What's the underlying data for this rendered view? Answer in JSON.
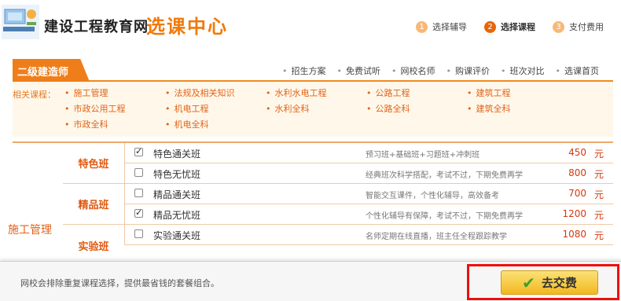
{
  "header": {
    "site_name": "建设工程教育网",
    "center_name": "选课中心",
    "steps": [
      {
        "num": "1",
        "label": "选择辅导"
      },
      {
        "num": "2",
        "label": "选择课程"
      },
      {
        "num": "3",
        "label": "支付费用"
      }
    ]
  },
  "category": {
    "title": "二级建造师",
    "links": [
      "招生方案",
      "免费试听",
      "网校名师",
      "购课评价",
      "班次对比",
      "选课首页"
    ]
  },
  "related": {
    "label": "相关课程：",
    "courses": [
      "施工管理",
      "法规及相关知识",
      "水利水电工程",
      "公路工程",
      "建筑工程",
      "市政公用工程",
      "机电工程",
      "水利全科",
      "公路全科",
      "建筑全科",
      "市政全科",
      "机电全科"
    ]
  },
  "table": {
    "subject": "施工管理",
    "groups": [
      {
        "name": "特色班"
      },
      {
        "name": "精品班"
      },
      {
        "name": "实验班"
      }
    ],
    "rows": [
      {
        "checked": true,
        "name": "特色通关班",
        "desc": "预习班+基础班+习题班+冲刺班",
        "price": "450",
        "unit": "元"
      },
      {
        "checked": false,
        "name": "特色无忧班",
        "desc": "经典班次科学搭配，考试不过，下期免费再学",
        "price": "800",
        "unit": "元"
      },
      {
        "checked": false,
        "name": "精品通关班",
        "desc": "智能交互课件，个性化辅导，高效备考",
        "price": "700",
        "unit": "元"
      },
      {
        "checked": true,
        "name": "精品无忧班",
        "desc": "个性化辅导有保障，考试不过，下期免费再学",
        "price": "1200",
        "unit": "元"
      },
      {
        "checked": false,
        "name": "实验通关班",
        "desc": "名师定期在线直播，班主任全程跟踪教学",
        "price": "1080",
        "unit": "元"
      }
    ]
  },
  "bottom": {
    "hint": "网校会排除重复课程选择，提供最省钱的套餐组合。",
    "pay_label": "去交费"
  }
}
